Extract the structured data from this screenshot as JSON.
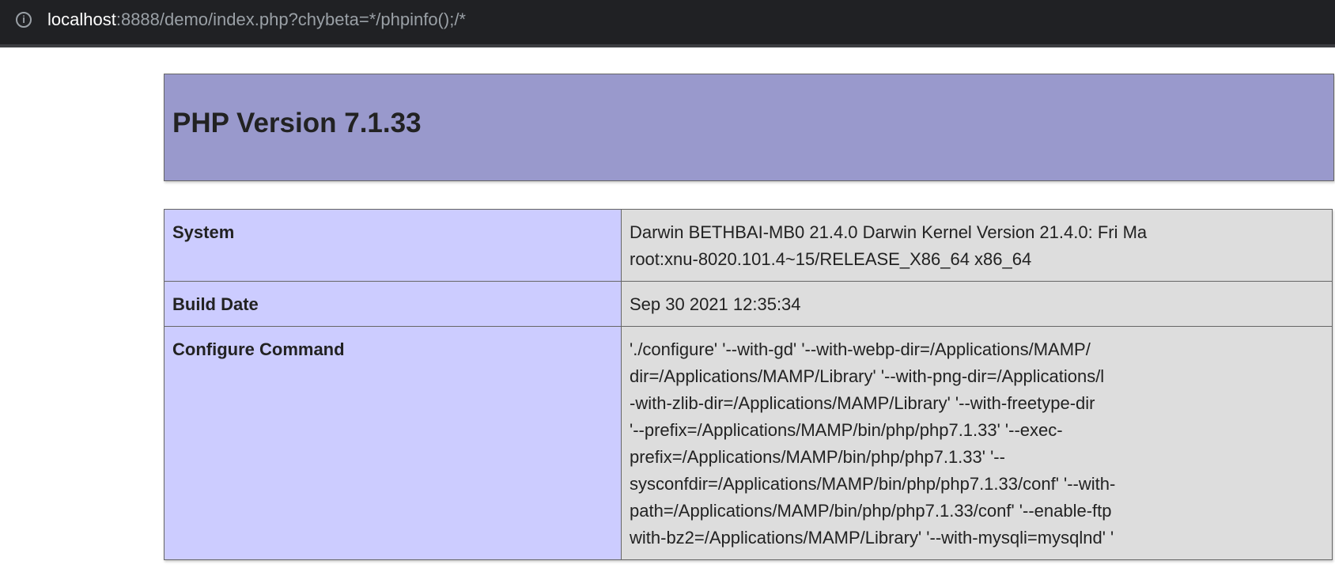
{
  "browser": {
    "url_host": "localhost",
    "url_rest": ":8888/demo/index.php?chybeta=*/phpinfo();/*",
    "icon": "info-icon"
  },
  "header": {
    "title": "PHP Version 7.1.33"
  },
  "colors": {
    "header_bg": "#9999cc",
    "label_bg": "#ccccff",
    "value_bg": "#dddddd"
  },
  "rows": [
    {
      "label": "System",
      "value_lines": [
        "Darwin BETHBAI-MB0 21.4.0 Darwin Kernel Version 21.4.0: Fri Ma",
        "root:xnu-8020.101.4~15/RELEASE_X86_64 x86_64"
      ]
    },
    {
      "label": "Build Date",
      "value_lines": [
        "Sep 30 2021 12:35:34"
      ]
    },
    {
      "label": "Configure Command",
      "value_lines": [
        "'./configure' '--with-gd' '--with-webp-dir=/Applications/MAMP/",
        "dir=/Applications/MAMP/Library' '--with-png-dir=/Applications/l",
        "-with-zlib-dir=/Applications/MAMP/Library' '--with-freetype-dir",
        "'--prefix=/Applications/MAMP/bin/php/php7.1.33' '--exec-",
        "prefix=/Applications/MAMP/bin/php/php7.1.33' '--",
        "sysconfdir=/Applications/MAMP/bin/php/php7.1.33/conf' '--with-",
        "path=/Applications/MAMP/bin/php/php7.1.33/conf' '--enable-ftp",
        "with-bz2=/Applications/MAMP/Library' '--with-mysqli=mysqlnd' '"
      ]
    }
  ]
}
